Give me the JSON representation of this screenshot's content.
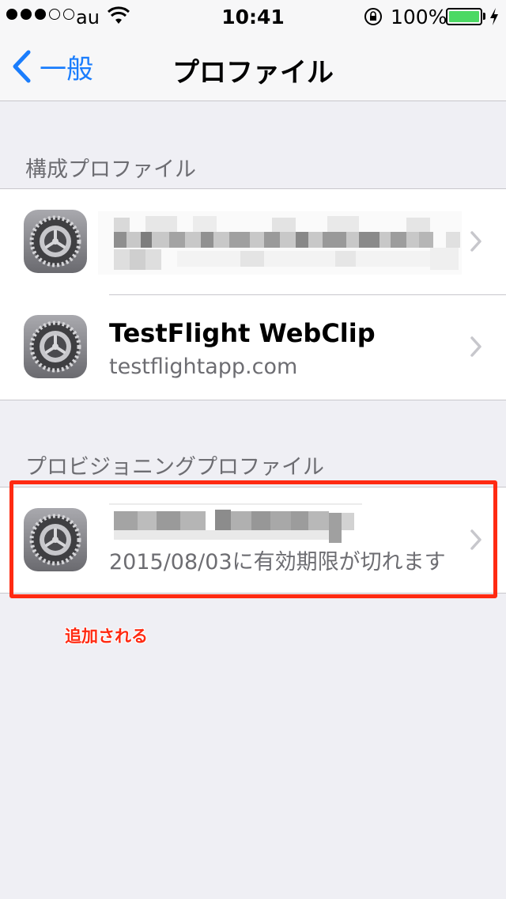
{
  "status_bar": {
    "carrier": "au",
    "time": "10:41",
    "battery_percent": "100%",
    "signal_bars_filled": 3,
    "signal_bars_total": 5,
    "battery_color": "#4cd964"
  },
  "nav": {
    "back_label": "一般",
    "title": "プロファイル",
    "accent_color": "#1a7dfd"
  },
  "sections": [
    {
      "header": "構成プロファイル",
      "items": [
        {
          "title": "",
          "subtitle": "",
          "redacted": true,
          "icon": "settings-gear-icon"
        },
        {
          "title": "TestFlight WebClip",
          "subtitle": "testflightapp.com",
          "redacted": false,
          "icon": "settings-gear-icon"
        }
      ]
    },
    {
      "header": "プロビジョニングプロファイル",
      "items": [
        {
          "title": "",
          "subtitle": "2015/08/03に有効期限が切れます",
          "redacted": true,
          "icon": "settings-gear-icon"
        }
      ]
    }
  ],
  "annotation": {
    "text": "追加される",
    "color": "#ff2a12"
  }
}
